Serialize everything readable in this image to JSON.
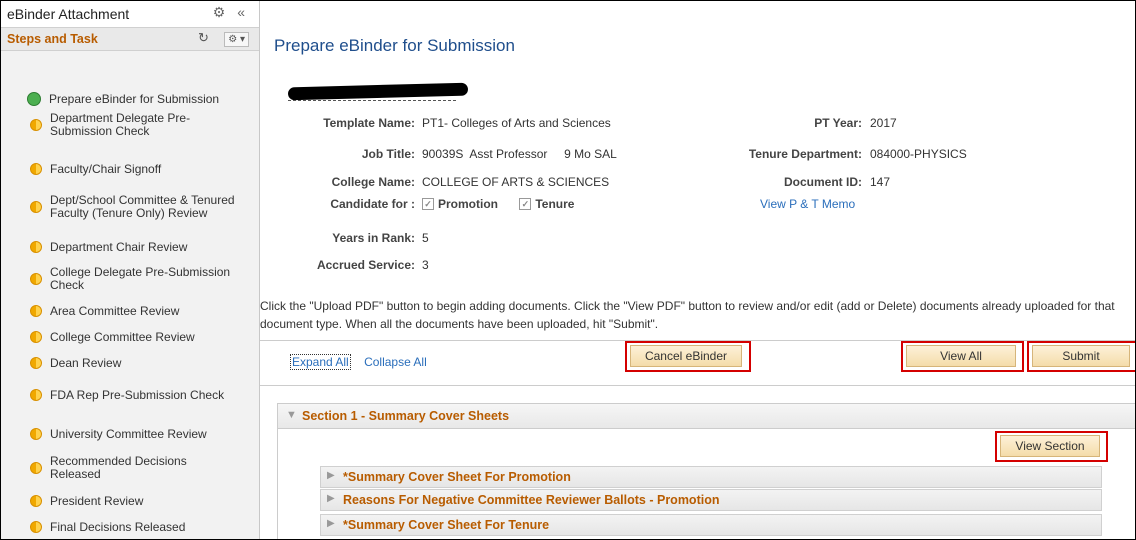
{
  "sidebar": {
    "title": "eBinder Attachment",
    "subtitle": "Steps and Task",
    "items": [
      {
        "label": "Prepare eBinder for Submission",
        "status": "complete"
      },
      {
        "label": "Department Delegate Pre-Submission Check",
        "status": "pending"
      },
      {
        "label": "Faculty/Chair Signoff",
        "status": "pending"
      },
      {
        "label": "Dept/School Committee & Tenured Faculty (Tenure Only) Review",
        "status": "pending"
      },
      {
        "label": "Department Chair Review",
        "status": "pending"
      },
      {
        "label": "College Delegate Pre-Submission Check",
        "status": "pending"
      },
      {
        "label": "Area Committee Review",
        "status": "pending"
      },
      {
        "label": "College Committee Review",
        "status": "pending"
      },
      {
        "label": "Dean Review",
        "status": "pending"
      },
      {
        "label": "FDA Rep Pre-Submission Check",
        "status": "pending"
      },
      {
        "label": "University Committee Review",
        "status": "pending"
      },
      {
        "label": "Recommended Decisions Released",
        "status": "pending"
      },
      {
        "label": "President Review",
        "status": "pending"
      },
      {
        "label": "Final Decisions Released",
        "status": "pending"
      }
    ]
  },
  "main": {
    "title": "Prepare eBinder for Submission",
    "fields": {
      "template_name_label": "Template Name:",
      "template_name": "PT1- Colleges of Arts and Sciences",
      "pt_year_label": "PT Year:",
      "pt_year": "2017",
      "job_title_label": "Job Title:",
      "job_title": "90039S  Asst Professor     9 Mo SAL",
      "tenure_dept_label": "Tenure Department:",
      "tenure_dept": "084000-PHYSICS",
      "college_name_label": "College Name:",
      "college_name": "COLLEGE OF ARTS & SCIENCES",
      "document_id_label": "Document ID:",
      "document_id": "147",
      "candidate_for_label": "Candidate for :",
      "promotion_label": "Promotion",
      "tenure_label": "Tenure",
      "memo_link": "View P & T Memo",
      "years_in_rank_label": "Years in Rank:",
      "years_in_rank": "5",
      "accrued_service_label": "Accrued Service:",
      "accrued_service": "3"
    },
    "instructions": "Click the \"Upload PDF\" button to begin adding documents. Click the \"View PDF\" button to review and/or edit (add or Delete) documents already uploaded for that document type. When all the documents have been uploaded, hit \"Submit\".",
    "expand_all": "Expand All",
    "collapse_all": "Collapse All",
    "cancel_label": "Cancel eBinder",
    "view_all_label": "View All",
    "submit_label": "Submit",
    "section": {
      "title": "Section 1 - Summary Cover Sheets",
      "view_section_label": "View Section",
      "rows": [
        "*Summary Cover Sheet For Promotion",
        "Reasons For Negative Committee Reviewer Ballots - Promotion",
        "*Summary Cover Sheet For Tenure"
      ]
    }
  }
}
